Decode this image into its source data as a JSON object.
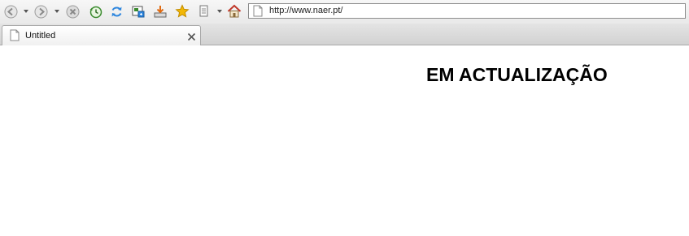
{
  "toolbar": {
    "icons": [
      "back-icon",
      "forward-icon",
      "stop-icon",
      "history-icon",
      "refresh-icon",
      "print-preview-icon",
      "download-icon",
      "favorites-star-icon",
      "page-menu-icon",
      "home-icon"
    ]
  },
  "address_bar": {
    "url": "http://www.naer.pt/"
  },
  "tabs": [
    {
      "title": "Untitled",
      "active": true
    }
  ],
  "page": {
    "heading": "EM ACTUALIZAÇÃO"
  },
  "colors": {
    "toolbar_bg": "#ececec",
    "home_icon_roof": "#c0392b",
    "star_icon": "#f2b705",
    "refresh_icon": "#2e86de"
  }
}
